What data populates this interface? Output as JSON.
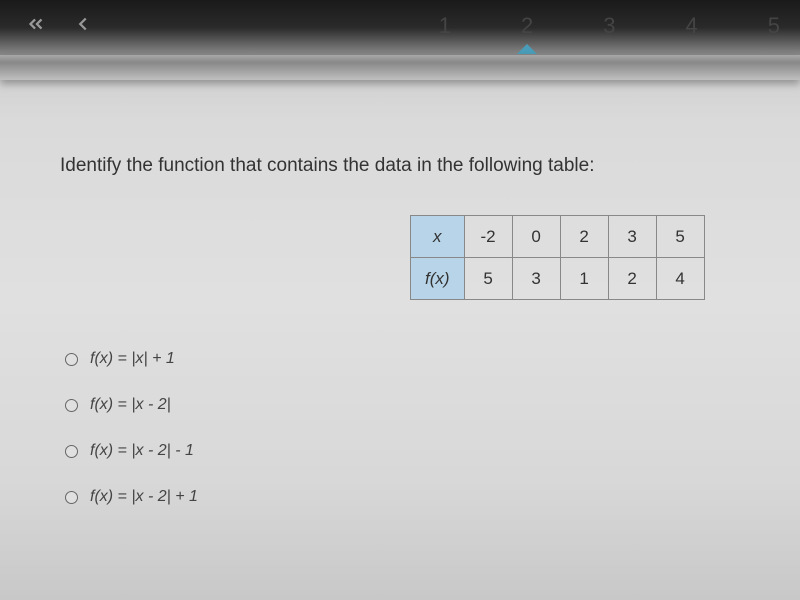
{
  "navigation": {
    "pages": [
      "1",
      "2",
      "3",
      "4",
      "5"
    ],
    "current": "2"
  },
  "question": {
    "text": "Identify the function that contains the data in the following table:"
  },
  "table": {
    "row1_header": "x",
    "row1": [
      "-2",
      "0",
      "2",
      "3",
      "5"
    ],
    "row2_header": "f(x)",
    "row2": [
      "5",
      "3",
      "1",
      "2",
      "4"
    ]
  },
  "options": {
    "a": "f(x) = |x| + 1",
    "b": "f(x) = |x - 2|",
    "c": "f(x) = |x - 2| - 1",
    "d": "f(x) = |x - 2| + 1"
  },
  "chart_data": {
    "type": "table",
    "title": "Function values table",
    "columns": [
      "x",
      "f(x)"
    ],
    "rows": [
      {
        "x": -2,
        "fx": 5
      },
      {
        "x": 0,
        "fx": 3
      },
      {
        "x": 2,
        "fx": 1
      },
      {
        "x": 3,
        "fx": 2
      },
      {
        "x": 5,
        "fx": 4
      }
    ]
  }
}
